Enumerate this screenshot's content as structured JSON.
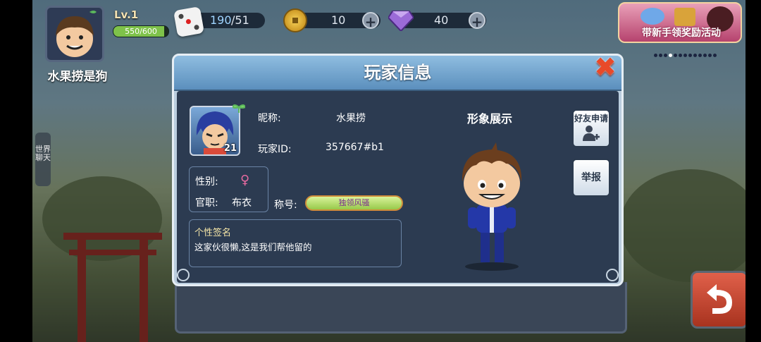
{
  "hud": {
    "level": "Lv.1",
    "exp_text": "550/600",
    "exp_fraction": 0.917,
    "player_name": "水果捞是狗",
    "dice": {
      "icon": "dice-icon",
      "current": "190",
      "max": "/51"
    },
    "coins": {
      "icon": "coin-icon",
      "value": "10",
      "plus": "+"
    },
    "gems": {
      "icon": "gem-icon",
      "value": "40",
      "plus": "+"
    },
    "banner_text": "带新手领奖励活动",
    "side_chat": "世界聊天"
  },
  "dialog": {
    "title": "玩家信息",
    "close_icon": "close-icon",
    "nickname_label": "昵称:",
    "nickname_value": "水果捞",
    "id_label": "玩家ID:",
    "id_value": "357667#b1",
    "avatar_level": "21",
    "gender_label": "性别:",
    "gender_icon": "female-icon",
    "gender_glyph": "♀",
    "rank_label": "官职:",
    "rank_value": "布衣",
    "title_label": "称号:",
    "title_badge": "独领风骚",
    "signature_label": "个性签名",
    "signature_text": "这家伙很懒,这是我们帮他留的",
    "showcase_label": "形象展示",
    "friend_request_label": "好友申请",
    "report_label": "举报"
  },
  "colors": {
    "panel_bg": "#2c3b51",
    "header": "#5b8fbd",
    "close": "#e84a2a",
    "badge_text": "#7a2d8f",
    "exp_fill": "#7ec24a"
  }
}
